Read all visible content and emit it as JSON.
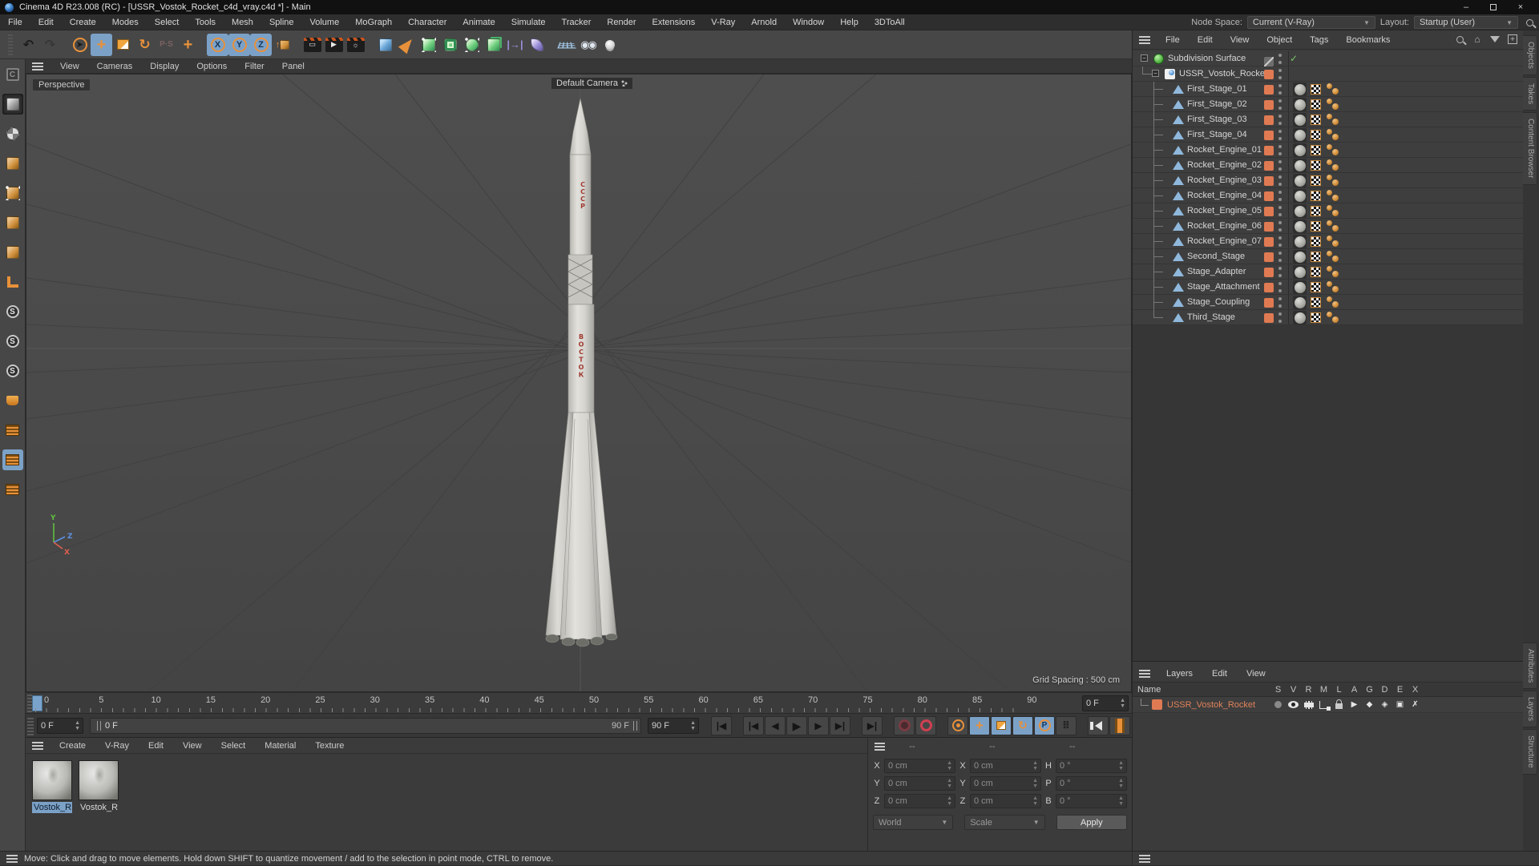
{
  "window": {
    "title": "Cinema 4D R23.008 (RC) - [USSR_Vostok_Rocket_c4d_vray.c4d *] - Main"
  },
  "menubar": {
    "items": [
      "File",
      "Edit",
      "Create",
      "Modes",
      "Select",
      "Tools",
      "Mesh",
      "Spline",
      "Volume",
      "MoGraph",
      "Character",
      "Animate",
      "Simulate",
      "Tracker",
      "Render",
      "Extensions",
      "V-Ray",
      "Arnold",
      "Window",
      "Help",
      "3DToAll"
    ],
    "node_space_label": "Node Space:",
    "node_space_value": "Current (V-Ray)",
    "layout_label": "Layout:",
    "layout_value": "Startup (User)"
  },
  "toolbar": {
    "icons": [
      {
        "name": "undo-icon",
        "glyph": "undo"
      },
      {
        "name": "redo-icon",
        "glyph": "redo",
        "state": "dim"
      },
      {
        "name": "sep",
        "glyph": "sep"
      },
      {
        "name": "live-selection-icon",
        "glyph": "select"
      },
      {
        "name": "move-tool-icon",
        "glyph": "move",
        "state": "active"
      },
      {
        "name": "scale-tool-icon",
        "glyph": "scale"
      },
      {
        "name": "rotate-tool-icon",
        "glyph": "rotate"
      },
      {
        "name": "last-tool-icon",
        "glyph": "ps",
        "state": "dim"
      },
      {
        "name": "axis-move-icon",
        "glyph": "move"
      },
      {
        "name": "sep",
        "glyph": "sep"
      },
      {
        "name": "lock-x-icon",
        "glyph": "X",
        "state": "active"
      },
      {
        "name": "lock-y-icon",
        "glyph": "Y",
        "state": "active"
      },
      {
        "name": "lock-z-icon",
        "glyph": "Z",
        "state": "active"
      },
      {
        "name": "coord-system-icon",
        "glyph": "coordsys"
      },
      {
        "name": "sep",
        "glyph": "sep"
      },
      {
        "name": "render-view-icon",
        "glyph": "clap"
      },
      {
        "name": "render-picture-viewer-icon",
        "glyph": "clap-play"
      },
      {
        "name": "render-settings-icon",
        "glyph": "clap-gear"
      },
      {
        "name": "sep",
        "glyph": "sep"
      },
      {
        "name": "primitive-cube-icon",
        "glyph": "cube-blue"
      },
      {
        "name": "spline-pen-icon",
        "glyph": "pen"
      },
      {
        "name": "subdivision-surface-icon",
        "glyph": "green-cage"
      },
      {
        "name": "generators-icon",
        "glyph": "green-hole"
      },
      {
        "name": "deformers-icon",
        "glyph": "green-dots"
      },
      {
        "name": "volume-icon",
        "glyph": "green-stack"
      },
      {
        "name": "fields-icon",
        "glyph": "purple-arrows"
      },
      {
        "name": "simulate-icon",
        "glyph": "purple-leaf"
      },
      {
        "name": "sep",
        "glyph": "sep"
      },
      {
        "name": "floor-icon",
        "glyph": "floor"
      },
      {
        "name": "camera-icon",
        "glyph": "camera"
      },
      {
        "name": "light-icon",
        "glyph": "light"
      }
    ]
  },
  "left_toolbar": {
    "icons": [
      {
        "name": "make-editable-icon",
        "glyph": "convert",
        "state": "dim"
      },
      {
        "name": "model-mode-icon",
        "glyph": "model",
        "state": "pressed"
      },
      {
        "name": "texture-mode-icon",
        "glyph": "texture"
      },
      {
        "name": "workplane-mode-icon",
        "glyph": "modecube"
      },
      {
        "name": "points-mode-icon",
        "glyph": "points"
      },
      {
        "name": "edges-mode-icon",
        "glyph": "modecube"
      },
      {
        "name": "polygons-mode-icon",
        "glyph": "modecube"
      },
      {
        "name": "tweak-mode-icon",
        "glyph": "ruler"
      },
      {
        "name": "snap-modeling-icon",
        "glyph": "sring"
      },
      {
        "name": "snap-auto-icon",
        "glyph": "sring"
      },
      {
        "name": "snap-3d-icon",
        "glyph": "sring"
      },
      {
        "name": "magnet-icon",
        "glyph": "pot"
      },
      {
        "name": "quantize-icon",
        "glyph": "mgrid"
      },
      {
        "name": "enable-snap-icon",
        "glyph": "mgrid",
        "state": "active"
      },
      {
        "name": "workplane-snap-icon",
        "glyph": "mgrid"
      }
    ]
  },
  "viewport": {
    "menu": [
      "View",
      "Cameras",
      "Display",
      "Options",
      "Filter",
      "Panel"
    ],
    "view_label": "Perspective",
    "camera_label": "Default Camera",
    "grid_spacing": "Grid Spacing : 500 cm",
    "axis_labels": {
      "x": "X",
      "y": "Y",
      "z": "Z"
    },
    "rocket_markings": {
      "upper": "СССР",
      "lower": "ВОСТОК"
    },
    "view_controls": [
      {
        "name": "pan-view-icon",
        "glyph": "+"
      },
      {
        "name": "zoom-view-icon",
        "glyph": "⇲"
      },
      {
        "name": "rotate-view-icon",
        "glyph": "↻"
      },
      {
        "name": "maximize-view-icon",
        "glyph": "▣"
      }
    ]
  },
  "timeline": {
    "ticks": [
      "0",
      "5",
      "10",
      "15",
      "20",
      "25",
      "30",
      "35",
      "40",
      "45",
      "50",
      "55",
      "60",
      "65",
      "70",
      "75",
      "80",
      "85",
      "90"
    ],
    "ruler_field": "0 F",
    "frame_field": "0 F",
    "slider_handle": "0 F",
    "slider_end": "90 F",
    "end_field": "90 F"
  },
  "transport": {
    "buttons": [
      {
        "name": "goto-start-button",
        "glyph": "skip-start"
      },
      {
        "name": "prev-key-button",
        "glyph": "skip-start",
        "gap": true
      },
      {
        "name": "prev-frame-button",
        "glyph": "prev"
      },
      {
        "name": "play-button",
        "glyph": "play"
      },
      {
        "name": "next-frame-button",
        "glyph": "next"
      },
      {
        "name": "next-key-button",
        "glyph": "skip-end"
      },
      {
        "name": "goto-end-button",
        "glyph": "skip-end",
        "gap": true
      },
      {
        "name": "record-keyframe-button",
        "glyph": "record-dim",
        "gap": true
      },
      {
        "name": "autokey-button",
        "glyph": "record-red"
      },
      {
        "name": "keyframe-selection-button",
        "glyph": "key-orange",
        "gap": true
      },
      {
        "name": "record-position-toggle",
        "glyph": "pos",
        "state": "active"
      },
      {
        "name": "record-scale-toggle",
        "glyph": "scl",
        "state": "active"
      },
      {
        "name": "record-rotation-toggle",
        "glyph": "rot",
        "state": "active"
      },
      {
        "name": "record-parameter-toggle",
        "glyph": "param",
        "state": "active"
      },
      {
        "name": "record-pla-toggle",
        "glyph": "pla"
      },
      {
        "name": "sound-toggle",
        "glyph": "sound",
        "gap": true
      },
      {
        "name": "motion-system-button",
        "glyph": "film"
      }
    ]
  },
  "materials": {
    "menu": [
      "Create",
      "V-Ray",
      "Edit",
      "View",
      "Select",
      "Material",
      "Texture"
    ],
    "items": [
      {
        "label": "Vostok_R",
        "selected": true
      },
      {
        "label": "Vostok_R",
        "selected": false
      }
    ]
  },
  "coordinates": {
    "headers": [
      "--",
      "--",
      "--"
    ],
    "rows": [
      {
        "l1": "X",
        "v1": "0 cm",
        "l2": "X",
        "v2": "0 cm",
        "l3": "H",
        "v3": "0 °"
      },
      {
        "l1": "Y",
        "v1": "0 cm",
        "l2": "Y",
        "v2": "0 cm",
        "l3": "P",
        "v3": "0 °"
      },
      {
        "l1": "Z",
        "v1": "0 cm",
        "l2": "Z",
        "v2": "0 cm",
        "l3": "B",
        "v3": "0 °"
      }
    ],
    "world": "World",
    "scale": "Scale",
    "apply": "Apply"
  },
  "object_manager": {
    "menu": [
      "File",
      "Edit",
      "View",
      "Object",
      "Tags",
      "Bookmarks"
    ],
    "toolbar_icons": [
      "search-icon",
      "home-icon",
      "filter-icon",
      "add-icon"
    ],
    "tree": [
      {
        "name": "Subdivision Surface",
        "icon": "sds",
        "depth": 0,
        "expand": true,
        "chip": "slash",
        "check": true
      },
      {
        "name": "USSR_Vostok_Rocket",
        "icon": "null",
        "depth": 1,
        "expand": true,
        "chip": "orange"
      },
      {
        "name": "First_Stage_01",
        "icon": "poly",
        "depth": 2,
        "chip": "orange",
        "tags": true
      },
      {
        "name": "First_Stage_02",
        "icon": "poly",
        "depth": 2,
        "chip": "orange",
        "tags": true
      },
      {
        "name": "First_Stage_03",
        "icon": "poly",
        "depth": 2,
        "chip": "orange",
        "tags": true
      },
      {
        "name": "First_Stage_04",
        "icon": "poly",
        "depth": 2,
        "chip": "orange",
        "tags": true
      },
      {
        "name": "Rocket_Engine_01",
        "icon": "poly",
        "depth": 2,
        "chip": "orange",
        "tags": true
      },
      {
        "name": "Rocket_Engine_02",
        "icon": "poly",
        "depth": 2,
        "chip": "orange",
        "tags": true
      },
      {
        "name": "Rocket_Engine_03",
        "icon": "poly",
        "depth": 2,
        "chip": "orange",
        "tags": true
      },
      {
        "name": "Rocket_Engine_04",
        "icon": "poly",
        "depth": 2,
        "chip": "orange",
        "tags": true
      },
      {
        "name": "Rocket_Engine_05",
        "icon": "poly",
        "depth": 2,
        "chip": "orange",
        "tags": true
      },
      {
        "name": "Rocket_Engine_06",
        "icon": "poly",
        "depth": 2,
        "chip": "orange",
        "tags": true
      },
      {
        "name": "Rocket_Engine_07",
        "icon": "poly",
        "depth": 2,
        "chip": "orange",
        "tags": true
      },
      {
        "name": "Second_Stage",
        "icon": "poly",
        "depth": 2,
        "chip": "orange",
        "tags": true
      },
      {
        "name": "Stage_Adapter",
        "icon": "poly",
        "depth": 2,
        "chip": "orange",
        "tags": true
      },
      {
        "name": "Stage_Attachment",
        "icon": "poly",
        "depth": 2,
        "chip": "orange",
        "tags": true
      },
      {
        "name": "Stage_Coupling",
        "icon": "poly",
        "depth": 2,
        "chip": "orange",
        "tags": true
      },
      {
        "name": "Third_Stage",
        "icon": "poly",
        "depth": 2,
        "chip": "orange",
        "tags": true,
        "last": true
      }
    ]
  },
  "layers_panel": {
    "menu": [
      "Layers",
      "Edit",
      "View"
    ],
    "name_header": "Name",
    "columns": [
      "S",
      "V",
      "R",
      "M",
      "L",
      "A",
      "G",
      "D",
      "E",
      "X"
    ],
    "rows": [
      {
        "name": "USSR_Vostok_Rocket"
      }
    ]
  },
  "side_tabs": {
    "top": [
      "Objects",
      "Takes",
      "Content Browser"
    ],
    "bottom": [
      "Attributes",
      "Layers",
      "Structure"
    ]
  },
  "status_bar": {
    "message": "Move: Click and drag to move elements. Hold down SHIFT to quantize movement / add to the selection in point mode, CTRL to remove."
  },
  "colors": {
    "accent_orange": "#e8913a",
    "selection_blue": "#7ba1c7",
    "layer_orange": "#e07a52",
    "record_red": "#d04050",
    "rocket_marking_red": "#a03a30"
  }
}
